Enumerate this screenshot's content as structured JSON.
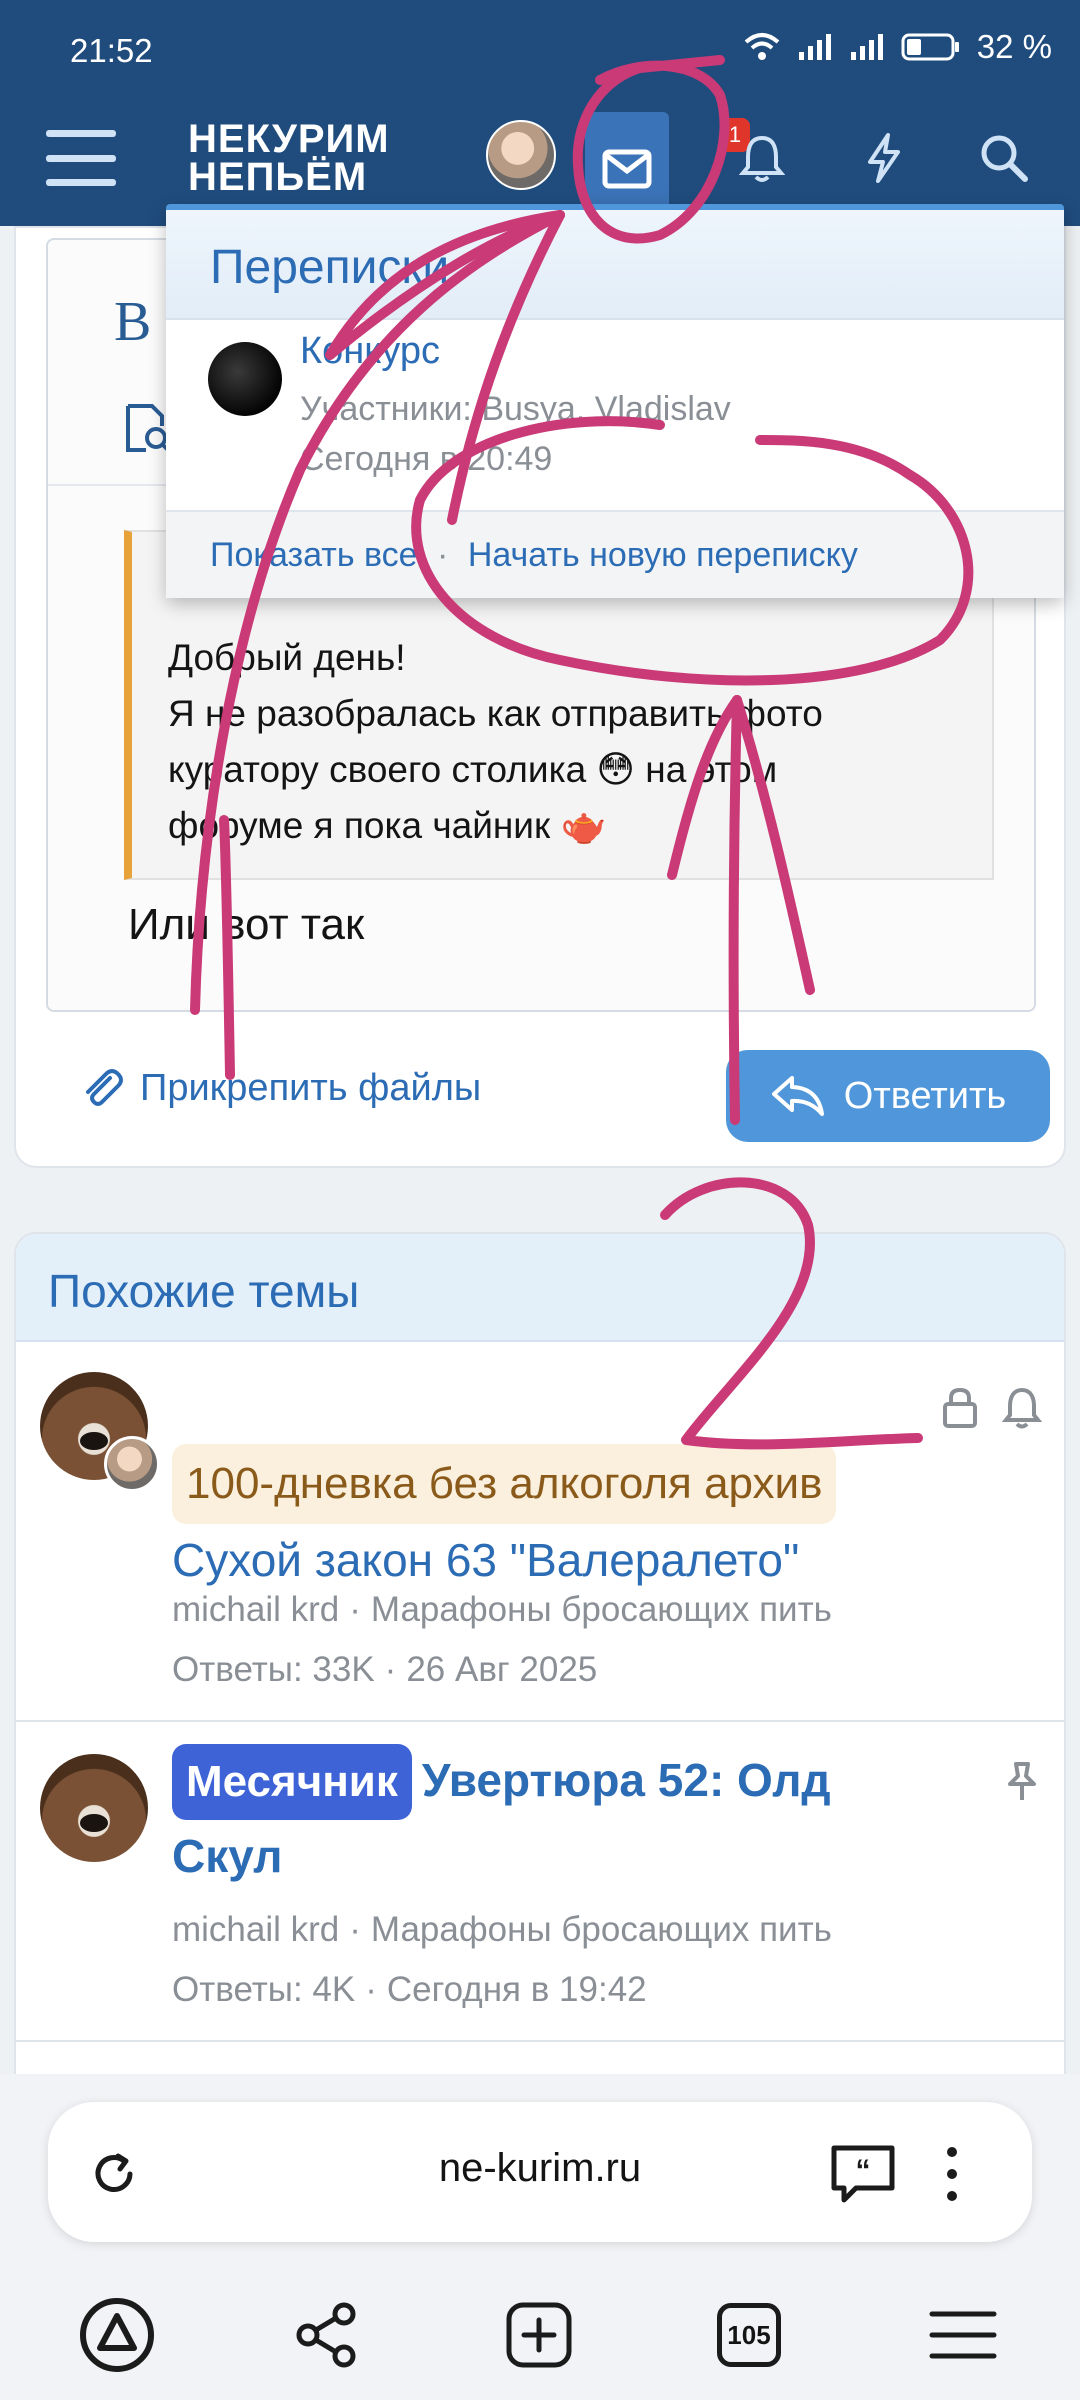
{
  "status_bar": {
    "time": "21:52",
    "battery": "32 %"
  },
  "header": {
    "logo_line1": "НЕКУРИМ",
    "logo_line2": "НЕПЬЁМ",
    "inbox_badge": "1",
    "icons": [
      "menu-icon",
      "avatar",
      "mail-icon",
      "bell-icon",
      "bolt-icon",
      "search-icon"
    ]
  },
  "editor": {
    "title_letter": "В",
    "quote_lines": [
      "Добрый день!",
      "Я не разобралась как отправить фото",
      "куратору своего столика 😳 на этом",
      "форуме я пока чайник 🫖"
    ],
    "reply_text": "Или вот так",
    "attach_label": "Прикрепить файлы",
    "reply_button": "Ответить"
  },
  "conversations_dropdown": {
    "title": "Переписки",
    "item": {
      "title": "Конкурс",
      "participants": "Участники: Busya, Vladislav",
      "time": "Сегодня в 20:49"
    },
    "show_all": "Показать все",
    "separator": "·",
    "start_new": "Начать новую переписку"
  },
  "similar_topics": {
    "heading": "Похожие темы",
    "topics": [
      {
        "prefix": "100-дневка без алкоголя архив",
        "title": "Сухой закон 63 \"Валералето\"",
        "author": "michail krd",
        "forum": "Марафоны бросающих пить",
        "replies": "Ответы: 33K",
        "date": "26 Авг 2025"
      },
      {
        "prefix": "Месячник",
        "title_line1": "Увертюра 52: Олд",
        "title_line2": "Скул",
        "author": "michail krd",
        "forum": "Марафоны бросающих пить",
        "replies": "Ответы: 4K",
        "date": "Сегодня в 19:42"
      }
    ]
  },
  "browser": {
    "url": "ne-kurim.ru",
    "tabs_count": "105"
  },
  "colors": {
    "header_bg": "#1f4c7d",
    "link": "#2b6cb5",
    "accent_button": "#4f97da",
    "annotation_ink": "#c93a76",
    "month_prefix": "#3d63d6",
    "quote_border": "#e8a23a"
  }
}
